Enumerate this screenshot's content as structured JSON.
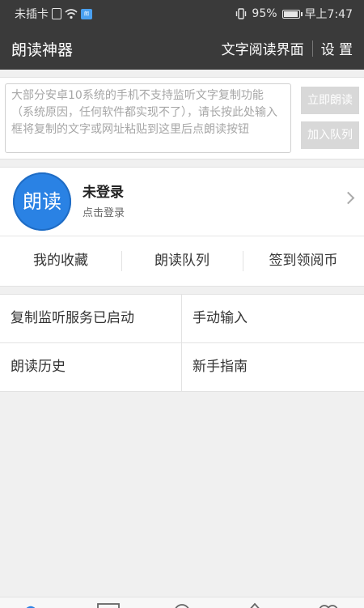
{
  "status_bar": {
    "carrier": "未插卡",
    "battery_percent": "95%",
    "battery_level": 0.95,
    "time": "早上7:47",
    "icons": [
      "sim-card-icon",
      "wifi-icon",
      "app-notification-icon",
      "vibrate-icon",
      "battery-icon"
    ]
  },
  "app_bar": {
    "title": "朗读神器",
    "text_reader_label": "文字阅读界面",
    "settings_label": "设 置"
  },
  "input_area": {
    "placeholder": "大部分安卓10系统的手机不支持监听文字复制功能（系统原因，任何软件都实现不了），请长按此处输入框将复制的文字或网址粘贴到这里后点朗读按钮",
    "read_now_label": "立即朗读",
    "add_queue_label": "加入队列"
  },
  "profile": {
    "avatar_text": "朗读",
    "name": "未登录",
    "subtitle": "点击登录"
  },
  "quick_actions": [
    "我的收藏",
    "朗读队列",
    "签到领阅币"
  ],
  "menu": {
    "copy_listen": "复制监听服务已启动",
    "manual_input": "手动输入",
    "read_history": "朗读历史",
    "beginner_guide": "新手指南"
  },
  "bottom_nav": {
    "icons": [
      "home-icon",
      "list-icon",
      "search-icon",
      "discover-icon",
      "profile-icon"
    ],
    "accent": "#2a82e4"
  },
  "colors": {
    "header_bg": "#3a3a3a",
    "avatar_bg": "#2a82e4",
    "disabled_button": "#d8d8d8"
  }
}
